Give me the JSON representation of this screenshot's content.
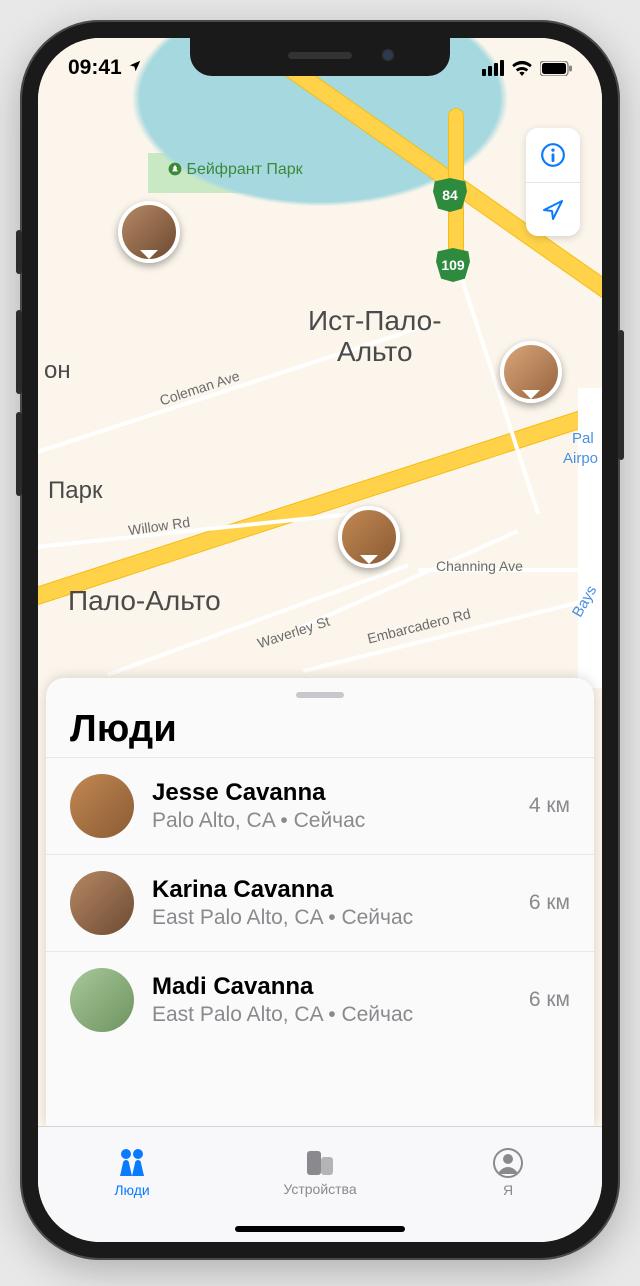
{
  "status": {
    "time": "09:41"
  },
  "map": {
    "park_label": "Бейфрант Парк",
    "city_main": "Ист-Пало-\nАльто",
    "city_below": "Пало-Альто",
    "label_park_left": "Парк",
    "label_on": "он",
    "street_coleman": "Coleman Ave",
    "street_willow": "Willow Rd",
    "street_waverley": "Waverley St",
    "street_embarcadero": "Embarcadero Rd",
    "street_channing": "Channing Ave",
    "label_pal": "Pal",
    "label_airpo": "Airpo",
    "label_bays": "Bays",
    "shield_84": "84",
    "shield_109": "109"
  },
  "sheet": {
    "title": "Люди",
    "people": [
      {
        "name": "Jesse Cavanna",
        "sub": "Palo Alto, CA • Сейчас",
        "dist": "4 км"
      },
      {
        "name": "Karina Cavanna",
        "sub": "East Palo Alto, CA • Сейчас",
        "dist": "6 км"
      },
      {
        "name": "Madi Cavanna",
        "sub": "East Palo Alto, CA • Сейчас",
        "dist": "6 км"
      }
    ]
  },
  "tabs": {
    "people": "Люди",
    "devices": "Устройства",
    "me": "Я"
  }
}
